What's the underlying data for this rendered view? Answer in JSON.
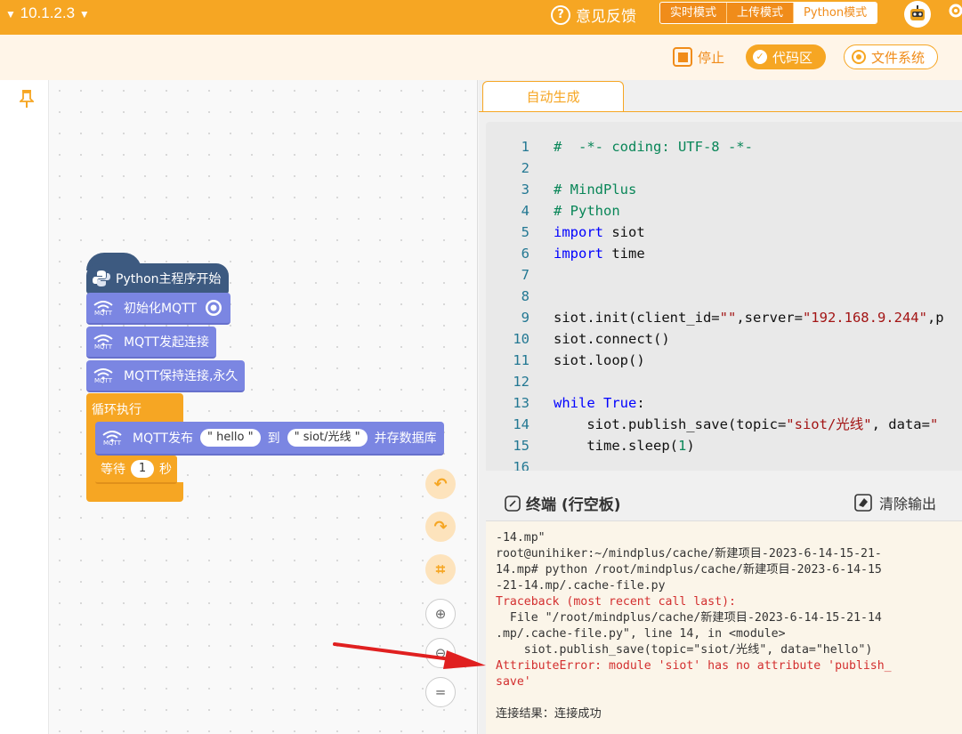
{
  "topbar": {
    "version": "10.1.2.3",
    "feedback": "意见反馈",
    "modes": [
      "实时模式",
      "上传模式",
      "Python模式"
    ]
  },
  "toolbar": {
    "stop": "停止",
    "code_area": "代码区",
    "file_system": "文件系统"
  },
  "blocks": {
    "hat": "Python主程序开始",
    "mqtt_init": "初始化MQTT",
    "mqtt_connect": "MQTT发起连接",
    "mqtt_keep": "MQTT保持连接,永久",
    "loop": "循环执行",
    "publish_label": "MQTT发布",
    "publish_msg": "\" hello \"",
    "publish_to": "到",
    "publish_topic": "\" siot/光线 \"",
    "publish_save": "并存数据库",
    "wait_label": "等待",
    "wait_value": "1",
    "wait_unit": "秒",
    "mqtt_icon_text": "MQTT"
  },
  "editor": {
    "tab": "自动生成",
    "lines": [
      {
        "n": "1",
        "html": "<span class='cm'>#  -*- coding: UTF-8 -*-</span>"
      },
      {
        "n": "2",
        "html": ""
      },
      {
        "n": "3",
        "html": "<span class='cm'># MindPlus</span>"
      },
      {
        "n": "4",
        "html": "<span class='cm'># Python</span>"
      },
      {
        "n": "5",
        "html": "<span class='kw'>import</span> siot"
      },
      {
        "n": "6",
        "html": "<span class='kw'>import</span> time"
      },
      {
        "n": "7",
        "html": ""
      },
      {
        "n": "8",
        "html": ""
      },
      {
        "n": "9",
        "html": "siot.init(client_id=<span class='st'>\"\"</span>,server=<span class='st'>\"192.168.9.244\"</span>,p"
      },
      {
        "n": "10",
        "html": "siot.connect()"
      },
      {
        "n": "11",
        "html": "siot.loop()"
      },
      {
        "n": "12",
        "html": ""
      },
      {
        "n": "13",
        "html": "<span class='kw'>while</span> <span class='kw'>True</span>:"
      },
      {
        "n": "14",
        "html": "    siot.publish_save(topic=<span class='st'>\"siot/光线\"</span>, data=<span class='st'>\"</span>"
      },
      {
        "n": "15",
        "html": "    time.sleep(<span class='nm'>1</span>)"
      },
      {
        "n": "16",
        "html": ""
      }
    ]
  },
  "terminal": {
    "title": "终端 (行空板)",
    "clear": "清除输出",
    "lines": [
      {
        "t": "-14.mp\"",
        "err": false
      },
      {
        "t": "root@unihiker:~/mindplus/cache/新建项目-2023-6-14-15-21-",
        "err": false
      },
      {
        "t": "14.mp# python /root/mindplus/cache/新建项目-2023-6-14-15",
        "err": false
      },
      {
        "t": "-21-14.mp/.cache-file.py",
        "err": false
      },
      {
        "t": "Traceback (most recent call last):",
        "err": true
      },
      {
        "t": "  File \"/root/mindplus/cache/新建项目-2023-6-14-15-21-14",
        "err": false
      },
      {
        "t": ".mp/.cache-file.py\", line 14, in <module>",
        "err": false
      },
      {
        "t": "    siot.publish_save(topic=\"siot/光线\", data=\"hello\")",
        "err": false
      },
      {
        "t": "AttributeError: module 'siot' has no attribute 'publish_",
        "err": true
      },
      {
        "t": "save'",
        "err": true
      },
      {
        "t": "",
        "err": false
      },
      {
        "t": "连接结果：连接成功",
        "err": false
      }
    ]
  },
  "colors": {
    "accent": "#f6a623",
    "mqtt_block": "#7b86e2",
    "hat_block": "#3d5a80",
    "error": "#d32f2f",
    "arrow": "#e02020"
  }
}
